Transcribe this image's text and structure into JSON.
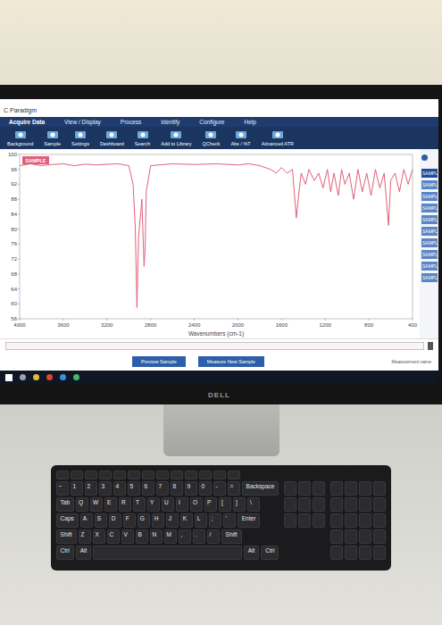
{
  "window": {
    "title": "C Paradigm"
  },
  "menu": [
    {
      "label": "Acquire Data",
      "selected": true
    },
    {
      "label": "View / Display",
      "selected": false
    },
    {
      "label": "Process",
      "selected": false
    },
    {
      "label": "Identify",
      "selected": false
    },
    {
      "label": "Configure",
      "selected": false
    },
    {
      "label": "Help",
      "selected": false
    }
  ],
  "toolbar": [
    {
      "label": "Background"
    },
    {
      "label": "Sample"
    },
    {
      "label": "Settings"
    },
    {
      "label": "Dashboard"
    },
    {
      "label": "Search"
    },
    {
      "label": "Add to Library"
    },
    {
      "label": "QCheck"
    },
    {
      "label": "Abs / %T"
    },
    {
      "label": "Advanced ATR"
    }
  ],
  "chart": {
    "series": [
      {
        "name": "SAMPLE",
        "color": "#e0607a",
        "wavenumbers": [
          4000,
          3900,
          3800,
          3700,
          3600,
          3500,
          3400,
          3300,
          3100,
          3000,
          2960,
          2940,
          2925,
          2910,
          2880,
          2860,
          2850,
          2840,
          2800,
          2600,
          2400,
          2200,
          2000,
          1900,
          1800,
          1700,
          1650,
          1600,
          1550,
          1500,
          1465,
          1440,
          1420,
          1380,
          1350,
          1300,
          1260,
          1220,
          1180,
          1150,
          1120,
          1080,
          1050,
          1020,
          980,
          940,
          900,
          860,
          820,
          780,
          740,
          700,
          660,
          620,
          600,
          560,
          520,
          480,
          440,
          400
        ],
        "values": [
          97,
          97.5,
          97,
          97.3,
          97.5,
          97,
          97.4,
          97.2,
          97.5,
          97,
          92,
          80,
          59,
          78,
          88,
          70,
          75,
          90,
          97,
          97.5,
          97.3,
          97.5,
          97.2,
          97.5,
          97,
          96,
          95,
          96.5,
          95,
          96,
          83,
          90,
          95,
          92,
          96,
          93,
          95,
          91,
          96,
          90,
          95,
          89,
          96,
          92,
          95,
          88,
          96,
          90,
          95,
          89,
          96,
          91,
          95,
          81,
          93,
          95,
          90,
          96,
          92,
          96
        ]
      }
    ],
    "y_ticks": [
      "100",
      "96",
      "92",
      "88",
      "84",
      "80",
      "76",
      "72",
      "68",
      "64",
      "60",
      "56"
    ],
    "x_ticks": [
      "4000",
      "3600",
      "3200",
      "2800",
      "2400",
      "2000",
      "1600",
      "1200",
      "800",
      "400"
    ],
    "x_label": "Wavenumbers (cm-1)"
  },
  "sidebar": {
    "items": [
      {
        "label": "SAMPL",
        "selected": true
      },
      {
        "label": "SAMPL",
        "selected": false
      },
      {
        "label": "SAMPL",
        "selected": false
      },
      {
        "label": "SAMPL",
        "selected": false
      },
      {
        "label": "SAMPL",
        "selected": false
      },
      {
        "label": "SAMPL",
        "selected": false
      },
      {
        "label": "SAMPL",
        "selected": false
      },
      {
        "label": "SAMPL",
        "selected": false
      },
      {
        "label": "SAMPL",
        "selected": false
      },
      {
        "label": "SAMPL",
        "selected": false
      }
    ]
  },
  "footer": {
    "buttons": [
      "Preview Sample",
      "Measure New Sample"
    ],
    "measurement_label": "Measurement name"
  },
  "monitor": {
    "brand": "DELL"
  },
  "keyboard": {
    "rows": [
      [
        "~",
        "1",
        "2",
        "3",
        "4",
        "5",
        "6",
        "7",
        "8",
        "9",
        "0",
        "-",
        "=",
        "Backspace"
      ],
      [
        "Tab",
        "Q",
        "W",
        "E",
        "R",
        "T",
        "Y",
        "U",
        "I",
        "O",
        "P",
        "[",
        "]",
        "\\"
      ],
      [
        "Caps",
        "A",
        "S",
        "D",
        "F",
        "G",
        "H",
        "J",
        "K",
        "L",
        ";",
        "'",
        "Enter"
      ],
      [
        "Shift",
        "Z",
        "X",
        "C",
        "V",
        "B",
        "N",
        "M",
        ",",
        ".",
        "/",
        "Shift"
      ],
      [
        "Ctrl",
        "Alt",
        "",
        "Alt",
        "Ctrl"
      ]
    ]
  }
}
